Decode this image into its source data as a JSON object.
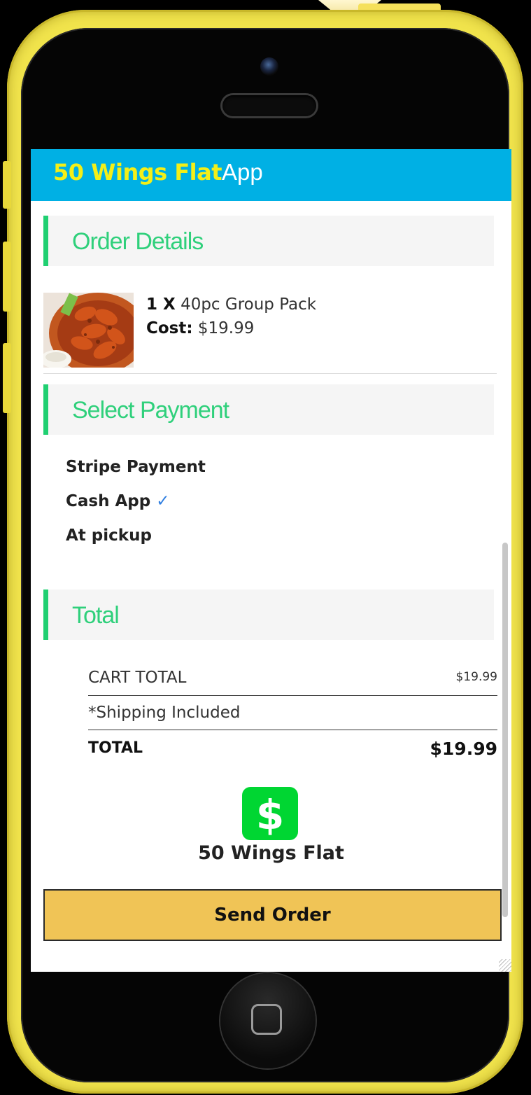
{
  "app": {
    "title_brand": "50 Wings Flat",
    "title_suffix": "App",
    "colors": {
      "app_bar": "#00b0e4",
      "brand_text": "#f3ef18",
      "section_accent": "#20d072",
      "send_button": "#f0c456",
      "cash_app_green": "#00d632"
    }
  },
  "order_details": {
    "heading": "Order Details",
    "item": {
      "quantity": "1 X",
      "name": "40pc Group Pack",
      "cost_label": "Cost:",
      "cost_value": "$19.99",
      "image_icon": "wings-photo"
    }
  },
  "select_payment": {
    "heading": "Select Payment",
    "options": [
      {
        "label": "Stripe Payment",
        "selected": false
      },
      {
        "label": "Cash App",
        "selected": true,
        "check": "✓"
      },
      {
        "label": "At pickup",
        "selected": false
      }
    ]
  },
  "total": {
    "heading": "Total",
    "cart_total_label": "CART TOTAL",
    "cart_total_value": "$19.99",
    "shipping_note": "*Shipping Included",
    "total_label": "TOTAL",
    "total_value": "$19.99"
  },
  "cash_app": {
    "icon": "cash-app-dollar-icon",
    "icon_glyph": "$",
    "name": "50 Wings Flat"
  },
  "send_order_label": "Send Order"
}
